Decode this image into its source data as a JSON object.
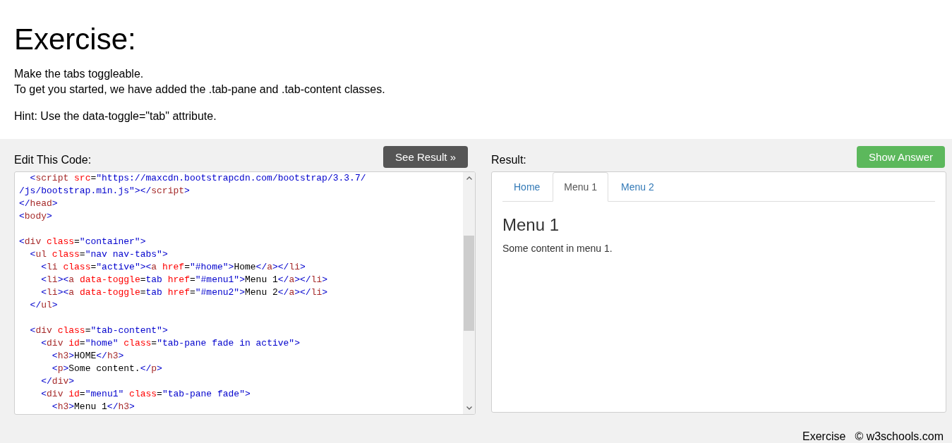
{
  "page": {
    "title": "Exercise:",
    "instructions": [
      "Make the tabs toggleable.",
      "To get you started, we have added the .tab-pane and .tab-content classes."
    ],
    "hint": "Hint: Use the data-toggle=\"tab\" attribute."
  },
  "editor": {
    "label": "Edit This Code:",
    "run_button": "See Result »",
    "code": "  <script src=\"https://maxcdn.bootstrapcdn.com/bootstrap/3.3.7/\n/js/bootstrap.min.js\"></script>\n</head>\n<body>\n\n<div class=\"container\">\n  <ul class=\"nav nav-tabs\">\n    <li class=\"active\"><a href=\"#home\">Home</a></li>\n    <li><a data-toggle=tab href=\"#menu1\">Menu 1</a></li>\n    <li><a data-toggle=tab href=\"#menu2\">Menu 2</a></li>\n  </ul>\n\n  <div class=\"tab-content\">\n    <div id=\"home\" class=\"tab-pane fade in active\">\n      <h3>HOME</h3>\n      <p>Some content.</p>\n    </div>\n    <div id=\"menu1\" class=\"tab-pane fade\">\n      <h3>Menu 1</h3>"
  },
  "result": {
    "label": "Result:",
    "answer_button": "Show Answer",
    "tabs": [
      {
        "label": "Home",
        "selected": false
      },
      {
        "label": "Menu 1",
        "selected": true
      },
      {
        "label": "Menu 2",
        "selected": false
      }
    ],
    "heading": "Menu 1",
    "text": "Some content in menu 1."
  },
  "footer": {
    "links": [
      "Exercise",
      "© w3schools.com"
    ]
  }
}
